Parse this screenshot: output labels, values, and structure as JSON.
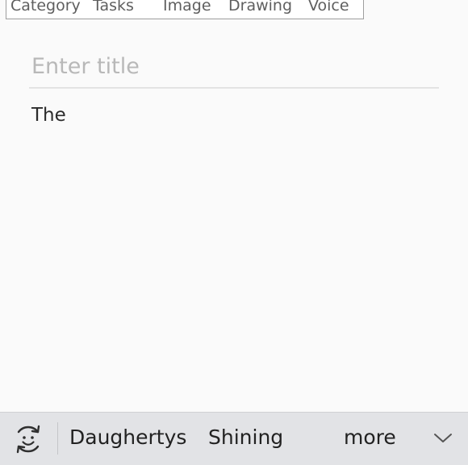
{
  "toolbar": {
    "items": [
      {
        "label": "Category"
      },
      {
        "label": "Tasks"
      },
      {
        "label": "Image"
      },
      {
        "label": "Drawing"
      },
      {
        "label": "Voice"
      }
    ]
  },
  "editor": {
    "title_placeholder": "Enter title",
    "title_value": "",
    "body_text": "The"
  },
  "keyboard_suggestions": {
    "emoji_icon": "emoji-toggle-icon",
    "words": [
      "Daughertys",
      "Shining",
      "more"
    ],
    "expand_icon": "chevron-down-icon"
  },
  "colors": {
    "background": "#fafafa",
    "toolbar_text": "#5f5f5f",
    "placeholder": "#b8b8b8",
    "suggestion_bar": "#e2e3e6"
  }
}
